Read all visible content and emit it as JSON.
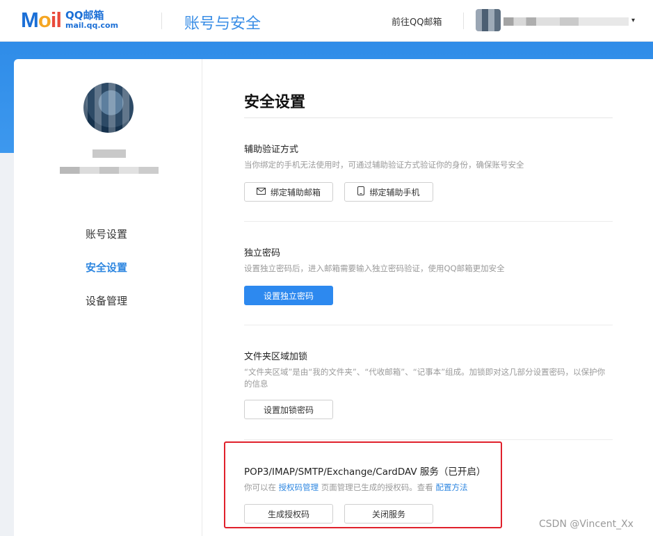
{
  "header": {
    "logo_text_top": "QQ邮箱",
    "logo_text_bottom": "mail.qq.com",
    "title": "账号与安全",
    "go_mail_link": "前往QQ邮箱",
    "caret": "▾"
  },
  "sidebar": {
    "nav": [
      {
        "label": "账号设置",
        "active": false
      },
      {
        "label": "安全设置",
        "active": true
      },
      {
        "label": "设备管理",
        "active": false
      }
    ]
  },
  "main": {
    "page_title": "安全设置",
    "sections": {
      "aux_verify": {
        "title": "辅助验证方式",
        "desc": "当你绑定的手机无法使用时，可通过辅助验证方式验证你的身份，确保账号安全",
        "btn_email": "绑定辅助邮箱",
        "btn_phone": "绑定辅助手机"
      },
      "independent_pw": {
        "title": "独立密码",
        "desc": "设置独立密码后，进入邮箱需要输入独立密码验证，使用QQ邮箱更加安全",
        "btn_set": "设置独立密码"
      },
      "folder_lock": {
        "title": "文件夹区域加锁",
        "desc": "“文件夹区域”是由“我的文件夹”、“代收邮箱”、“记事本”组成。加锁即对这几部分设置密码，以保护你的信息",
        "btn_set": "设置加锁密码"
      },
      "pop3": {
        "title": "POP3/IMAP/SMTP/Exchange/CardDAV 服务（已开启）",
        "desc_prefix": "你可以在 ",
        "desc_link1": "授权码管理",
        "desc_middle": " 页面管理已生成的授权码。查看 ",
        "desc_link2": "配置方法",
        "btn_generate": "生成授权码",
        "btn_close": "关闭服务"
      }
    }
  },
  "watermark": "CSDN @Vincent_Xx",
  "colors": {
    "accent": "#2f87e0",
    "primary_button": "#2d89ef",
    "highlight_box": "#e0202b",
    "band": "#2f8ce8"
  },
  "icons": {
    "email_button": "mail-icon",
    "phone_button": "phone-icon"
  }
}
